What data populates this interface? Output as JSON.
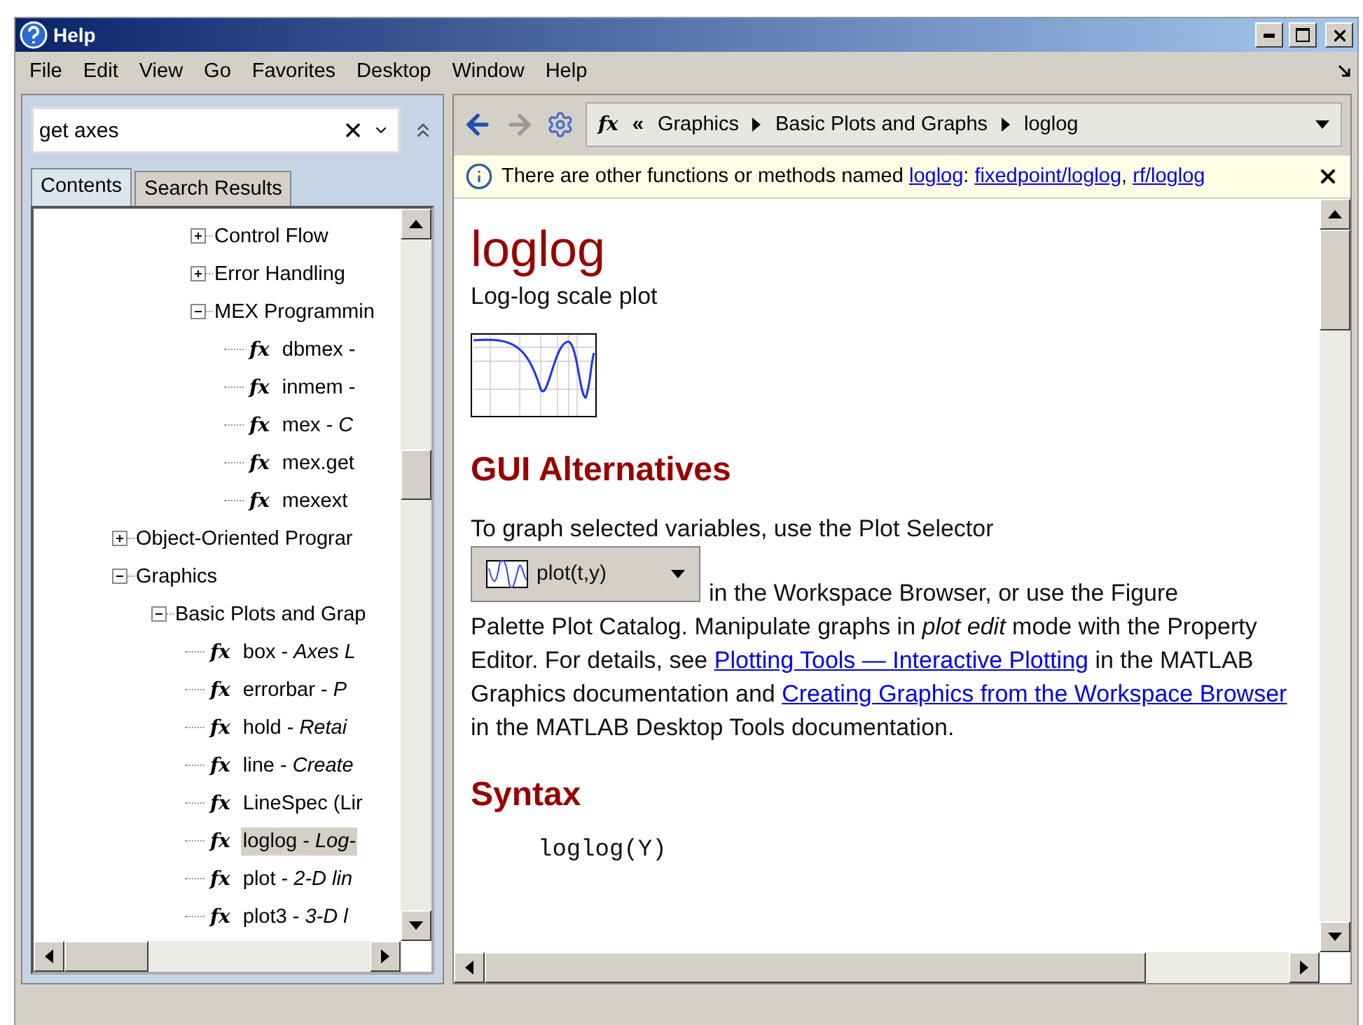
{
  "window": {
    "title": "Help"
  },
  "menu": [
    "File",
    "Edit",
    "View",
    "Go",
    "Favorites",
    "Desktop",
    "Window",
    "Help"
  ],
  "search": {
    "value": "get axes"
  },
  "tabs": [
    {
      "label": "Contents",
      "selected": true
    },
    {
      "label": "Search Results",
      "selected": false
    }
  ],
  "tree": [
    {
      "kind": "branch",
      "children": [
        {
          "kind": "branch",
          "children": [
            {
              "kind": "folder",
              "label": "Control Flow",
              "expanded": false
            },
            {
              "kind": "folder",
              "label": "Error Handling",
              "expanded": false
            },
            {
              "kind": "folder",
              "label": "MEX Programmin",
              "expanded": true,
              "children": [
                {
                  "kind": "function",
                  "glyph": "fx",
                  "text": "dbmex -",
                  "selected": false
                },
                {
                  "kind": "function",
                  "glyph": "fx",
                  "text": "inmem -",
                  "selected": false
                },
                {
                  "kind": "function",
                  "glyph": "fx",
                  "text": "mex - *C*",
                  "selected": false
                },
                {
                  "kind": "function",
                  "glyph": "fx",
                  "text": "mex.get",
                  "selected": false
                },
                {
                  "kind": "function",
                  "glyph": "fx",
                  "text": "mexext",
                  "selected": false
                }
              ]
            }
          ]
        }
      ]
    },
    {
      "kind": "folder",
      "label": "Object-Oriented Prograr",
      "expanded": false
    },
    {
      "kind": "folder",
      "label": "Graphics",
      "expanded": true,
      "children": [
        {
          "kind": "folder",
          "label": "Basic Plots and Grap",
          "expanded": true,
          "children": [
            {
              "kind": "function",
              "glyph": "fx",
              "text": "box - *Axes L*",
              "selected": false
            },
            {
              "kind": "function",
              "glyph": "fx",
              "text": "errorbar - *P*",
              "selected": false
            },
            {
              "kind": "function",
              "glyph": "fx",
              "text": "hold - *Retai*",
              "selected": false
            },
            {
              "kind": "function",
              "glyph": "fx",
              "text": "line - *Create*",
              "selected": false
            },
            {
              "kind": "function",
              "glyph": "fx",
              "text": "LineSpec (Lir",
              "selected": false
            },
            {
              "kind": "function",
              "glyph": "fx",
              "text": "loglog - *Log-*",
              "selected": true
            },
            {
              "kind": "function",
              "glyph": "fx",
              "text": "plot - *2-D lin*",
              "selected": false
            },
            {
              "kind": "function",
              "glyph": "fx",
              "text": "plot3 - *3-D l*",
              "selected": false
            }
          ]
        }
      ]
    }
  ],
  "breadcrumb": {
    "glyph": "fx",
    "lead": "«",
    "items": [
      "Graphics",
      "Basic Plots and Graphs",
      "loglog"
    ]
  },
  "notice": [
    {
      "kind": "text",
      "text": "There are other functions or methods named "
    },
    {
      "kind": "link",
      "text": "loglog"
    },
    {
      "kind": "text",
      "text": ": "
    },
    {
      "kind": "link",
      "text": "fixedpoint/loglog"
    },
    {
      "kind": "text",
      "text": ", "
    },
    {
      "kind": "link",
      "text": "rf/loglog"
    }
  ],
  "page": {
    "title": "loglog",
    "subtitle": "Log-log scale plot",
    "gui_heading": "GUI Alternatives",
    "intro": "To graph selected variables, use the Plot Selector",
    "plot_selector": "plot(t,y)",
    "selector_line": "in the Workspace Browser, or use the Figure",
    "body": [
      {
        "kind": "text",
        "text": "Palette Plot Catalog. Manipulate graphs in *plot edit* mode with the Property Editor. For details, see "
      },
      {
        "kind": "link",
        "text": "Plotting Tools — Interactive Plotting"
      },
      {
        "kind": "text",
        "text": " in the MATLAB Graphics documentation and "
      },
      {
        "kind": "link",
        "text": "Creating Graphics from the Workspace Browser"
      },
      {
        "kind": "text",
        "text": " in the MATLAB Desktop Tools documentation."
      }
    ],
    "syntax_heading": "Syntax",
    "code": "loglog(Y)"
  }
}
